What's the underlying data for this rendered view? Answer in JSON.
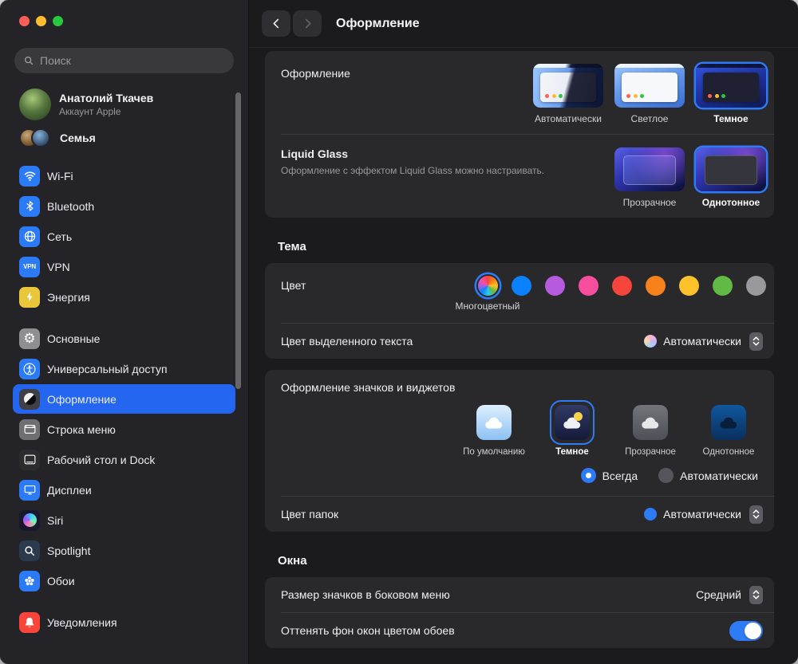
{
  "window": {
    "accent_color": "#2e7bf6"
  },
  "header": {
    "title": "Оформление"
  },
  "sidebar": {
    "search": {
      "placeholder": "Поиск"
    },
    "profile": {
      "name": "Анатолий Ткачев",
      "subtitle": "Аккаунт Apple"
    },
    "family": {
      "label": "Семья"
    },
    "items": [
      {
        "label": "Wi-Fi",
        "icon": "wifi-icon",
        "color": "#2b7bf6"
      },
      {
        "label": "Bluetooth",
        "icon": "bluetooth-icon",
        "color": "#2b7bf6"
      },
      {
        "label": "Сеть",
        "icon": "globe-icon",
        "color": "#2b7bf6"
      },
      {
        "label": "VPN",
        "icon": "vpn-icon",
        "color": "#2b7bf6"
      },
      {
        "label": "Энергия",
        "icon": "bolt-icon",
        "color": "#e9c63a"
      },
      {
        "label": "Основные",
        "icon": "gear-icon",
        "color": "#8e8e93"
      },
      {
        "label": "Универсальный доступ",
        "icon": "accessibility-icon",
        "color": "#2b7bf6"
      },
      {
        "label": "Оформление",
        "icon": "appearance-icon",
        "color": "#3f3f45",
        "selected": true
      },
      {
        "label": "Строка меню",
        "icon": "menubar-icon",
        "color": "#6e6e73"
      },
      {
        "label": "Рабочий стол и Dock",
        "icon": "desktop-dock-icon",
        "color": "#2c2c2e"
      },
      {
        "label": "Дисплеи",
        "icon": "display-icon",
        "color": "#2b7bf6"
      },
      {
        "label": "Siri",
        "icon": "siri-icon",
        "color": "#17172e"
      },
      {
        "label": "Spotlight",
        "icon": "spotlight-icon",
        "color": "#2b3a4d"
      },
      {
        "label": "Обои",
        "icon": "wallpaper-icon",
        "color": "#2b7bf6"
      },
      {
        "label": "Уведомления",
        "icon": "bell-icon",
        "color": "#fc453a"
      }
    ]
  },
  "main": {
    "appearance": {
      "label": "Оформление",
      "options": [
        {
          "label": "Автоматически",
          "selected": false
        },
        {
          "label": "Светлое",
          "selected": false
        },
        {
          "label": "Темное",
          "selected": true
        }
      ]
    },
    "liquid_glass": {
      "title": "Liquid Glass",
      "description": "Оформление с эффектом Liquid Glass можно настраивать.",
      "options": [
        {
          "label": "Прозрачное",
          "selected": false
        },
        {
          "label": "Однотонное",
          "selected": true
        }
      ]
    },
    "theme": {
      "title": "Тема",
      "accent": {
        "label": "Цвет",
        "selected_name": "Многоцветный",
        "palette": [
          "multicolor",
          "#0a82ff",
          "#b65be0",
          "#f74f9e",
          "#f5453c",
          "#f7821b",
          "#fdc129",
          "#62ba46",
          "#98989d"
        ]
      },
      "highlight": {
        "label": "Цвет выделенного текста",
        "value": "Автоматически"
      },
      "icons_widgets": {
        "label": "Оформление значков и виджетов",
        "options": [
          {
            "label": "По умолчанию",
            "selected": false
          },
          {
            "label": "Темное",
            "selected": true
          },
          {
            "label": "Прозрачное",
            "selected": false
          },
          {
            "label": "Однотонное",
            "selected": false
          }
        ],
        "modes": [
          {
            "label": "Всегда",
            "selected": true
          },
          {
            "label": "Автоматически",
            "selected": false
          }
        ]
      },
      "folders": {
        "label": "Цвет папок",
        "value": "Автоматически"
      }
    },
    "windows": {
      "title": "Окна",
      "sidebar_icon_size": {
        "label": "Размер значков в боковом меню",
        "value": "Средний"
      },
      "tint": {
        "label": "Оттенять фон окон цветом обоев",
        "enabled": true
      }
    }
  }
}
